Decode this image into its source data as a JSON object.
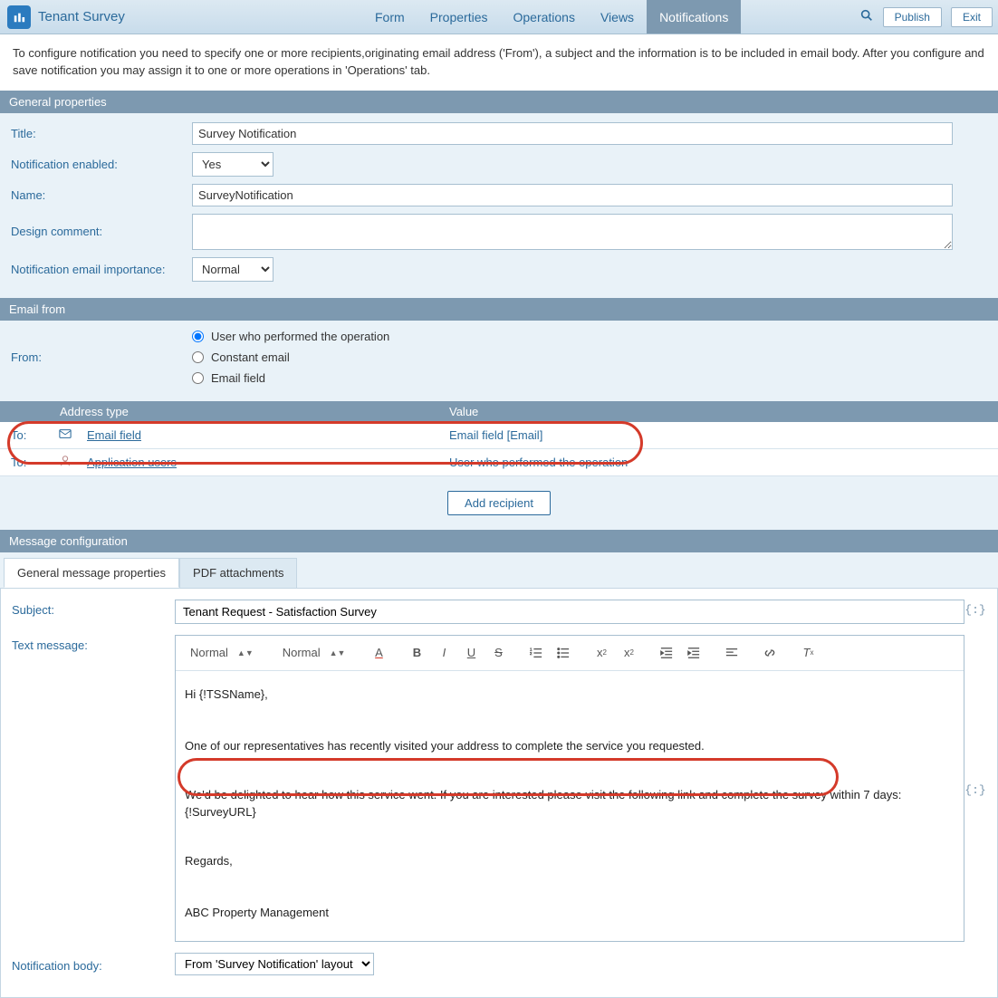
{
  "header": {
    "title": "Tenant Survey",
    "nav": [
      "Form",
      "Properties",
      "Operations",
      "Views",
      "Notifications"
    ],
    "nav_active": 4,
    "publish": "Publish",
    "exit": "Exit"
  },
  "intro": "To configure notification you need to specify one or more recipients,originating email address ('From'), a subject and the information is to be included in email body. After you configure and save notification you may assign it to one or more operations in 'Operations' tab.",
  "general": {
    "section_title": "General properties",
    "title_label": "Title:",
    "title_value": "Survey Notification",
    "enabled_label": "Notification enabled:",
    "enabled_value": "Yes",
    "name_label": "Name:",
    "name_value": "SurveyNotification",
    "comment_label": "Design comment:",
    "comment_value": "",
    "importance_label": "Notification email importance:",
    "importance_value": "Normal"
  },
  "email_from": {
    "section_title": "Email from",
    "from_label": "From:",
    "options": [
      "User who performed the operation",
      "Constant email",
      "Email field"
    ],
    "selected": 0
  },
  "recipients": {
    "header_addr": "Address type",
    "header_val": "Value",
    "rows": [
      {
        "to": "To:",
        "type": "Email field",
        "value": "Email field [Email]"
      },
      {
        "to": "To:",
        "type": "Application users",
        "value": "User who performed the operation"
      }
    ],
    "add_label": "Add recipient"
  },
  "message": {
    "section_title": "Message configuration",
    "tabs": [
      "General message properties",
      "PDF attachments"
    ],
    "tab_active": 0,
    "subject_label": "Subject:",
    "subject_value": "Tenant Request - Satisfaction Survey",
    "text_label": "Text message:",
    "toolbar_style1": "Normal",
    "toolbar_style2": "Normal",
    "body_lines": {
      "l1": "Hi {!TSSName},",
      "l2": "One of our representatives has recently visited your address to complete the service you requested.",
      "l3a": "We'd be delighted to hear how this service went. If you are interested please visit the following link and complete the survey within 7 days:",
      "l3b": "{!SurveyURL}",
      "l4": "Regards,",
      "l5": "ABC Property Management"
    },
    "body_label": "Notification body:",
    "body_value": "From 'Survey Notification' layout"
  }
}
